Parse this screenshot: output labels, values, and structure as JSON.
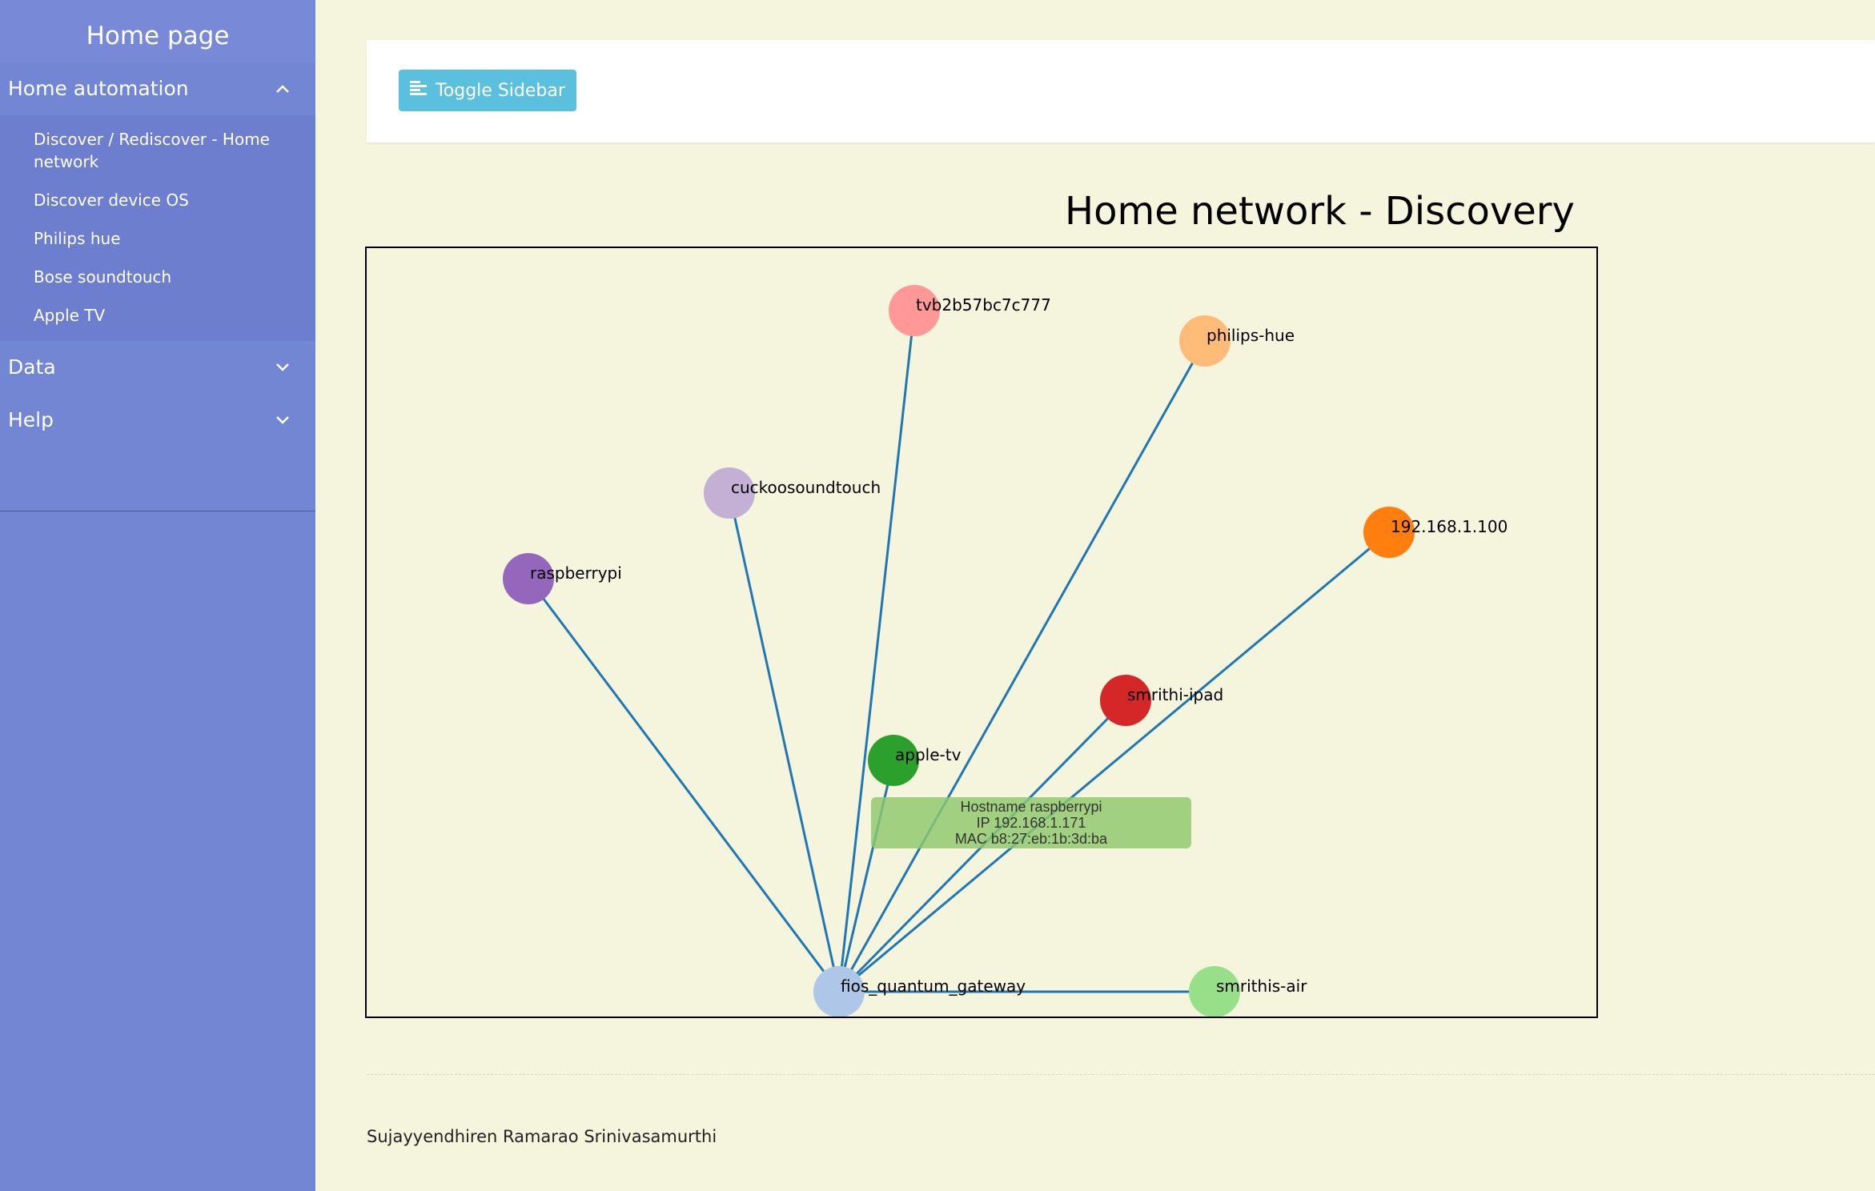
{
  "sidebar": {
    "title": "Home page",
    "groups": [
      {
        "label": "Home automation",
        "items": [
          {
            "label": "Discover / Rediscover - Home network"
          },
          {
            "label": "Discover device OS"
          },
          {
            "label": "Philips hue"
          },
          {
            "label": "Bose soundtouch"
          },
          {
            "label": "Apple TV"
          }
        ]
      },
      {
        "label": "Data"
      },
      {
        "label": "Help"
      }
    ]
  },
  "toolbar": {
    "toggle_label": "Toggle Sidebar"
  },
  "page": {
    "title": "Home network - Discovery",
    "footer": "Sujayyendhiren Ramarao Srinivasamurthi"
  },
  "network": {
    "hub": "fios_quantum_gateway",
    "nodes": [
      {
        "name": "tvb2b57bc7c777",
        "color": "#ff9896"
      },
      {
        "name": "philips-hue",
        "color": "#ffbb78"
      },
      {
        "name": "cuckoosoundtouch",
        "color": "#c5b0d5"
      },
      {
        "name": "raspberrypi",
        "color": "#9467bd"
      },
      {
        "name": "192.168.1.100",
        "color": "#ff7f0e"
      },
      {
        "name": "smrithi-ipad",
        "color": "#d62728"
      },
      {
        "name": "apple-tv",
        "color": "#2ca02c"
      },
      {
        "name": "fios_quantum_gateway",
        "color": "#aec7e8"
      },
      {
        "name": "smrithis-air",
        "color": "#98df8a"
      }
    ],
    "link_color": "#1f77b4",
    "tooltip": {
      "hostname": "Hostname raspberrypi",
      "ip": "IP 192.168.1.171",
      "mac": "MAC b8:27:eb:1b:3d:ba"
    }
  }
}
